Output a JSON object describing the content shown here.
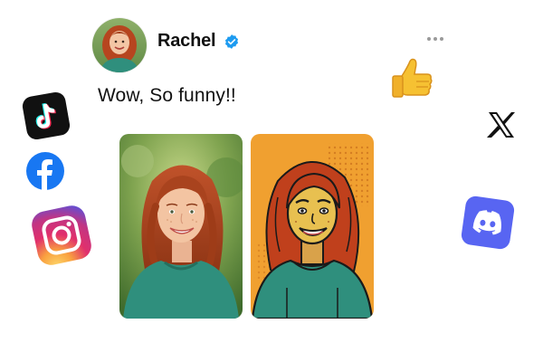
{
  "post": {
    "author_name": "Rachel",
    "verified": true,
    "text": "Wow, So funny!!",
    "more_icon": "ellipsis-icon",
    "images": [
      {
        "kind": "photo",
        "description_icon": "original-photo"
      },
      {
        "kind": "cartoon",
        "description_icon": "cartoon-portrait"
      }
    ]
  },
  "floating_icons": [
    {
      "name": "thumbs-up-icon"
    },
    {
      "name": "tiktok-icon"
    },
    {
      "name": "facebook-icon"
    },
    {
      "name": "instagram-icon"
    },
    {
      "name": "x-icon"
    },
    {
      "name": "discord-icon"
    }
  ],
  "colors": {
    "verified_blue": "#1d9bf0",
    "facebook_blue": "#1877f2",
    "discord_blurple": "#5865f2",
    "cartoon_bg": "#f0a030",
    "shirt_teal": "#2f8f7d",
    "hair_red": "#b6451f"
  }
}
